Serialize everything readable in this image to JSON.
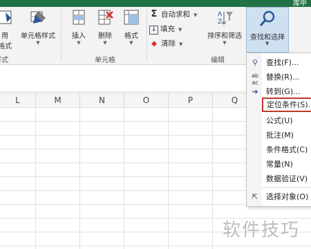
{
  "window": {
    "title_fragment": "库中"
  },
  "ribbon": {
    "styles_group": {
      "label": "样式",
      "left_btn_label_1": "用",
      "left_btn_label_2": "格式",
      "cell_styles_label": "单元格样式"
    },
    "cells_group": {
      "label": "单元格",
      "insert_label": "插入",
      "delete_label": "删除",
      "format_label": "格式"
    },
    "editing_group": {
      "label": "编辑",
      "autosum_label": "自动求和",
      "fill_label": "填充",
      "clear_label": "清除",
      "sort_filter_label": "排序和筛选",
      "find_select_label": "查找和选择"
    }
  },
  "columns": [
    "L",
    "M",
    "N",
    "O",
    "P",
    "Q"
  ],
  "dropdown": {
    "items": [
      {
        "label": "查找(F)...",
        "icon": "search-icon"
      },
      {
        "label": "替换(R)...",
        "icon": "replace-icon"
      },
      {
        "label": "转到(G)...",
        "icon": "arrow-right-icon"
      },
      {
        "label": "定位条件(S)...",
        "icon": "",
        "highlighted": true
      },
      {
        "label": "公式(U)",
        "icon": ""
      },
      {
        "label": "批注(M)",
        "icon": ""
      },
      {
        "label": "条件格式(C)",
        "icon": ""
      },
      {
        "label": "常量(N)",
        "icon": ""
      },
      {
        "label": "数据验证(V)",
        "icon": ""
      },
      {
        "label": "选择对象(O)",
        "icon": "cursor-icon"
      }
    ]
  },
  "watermark": "软件技巧",
  "colors": {
    "title_green": "#217346",
    "highlight_red": "#c0392b",
    "button_selected": "#cfe0f1"
  }
}
